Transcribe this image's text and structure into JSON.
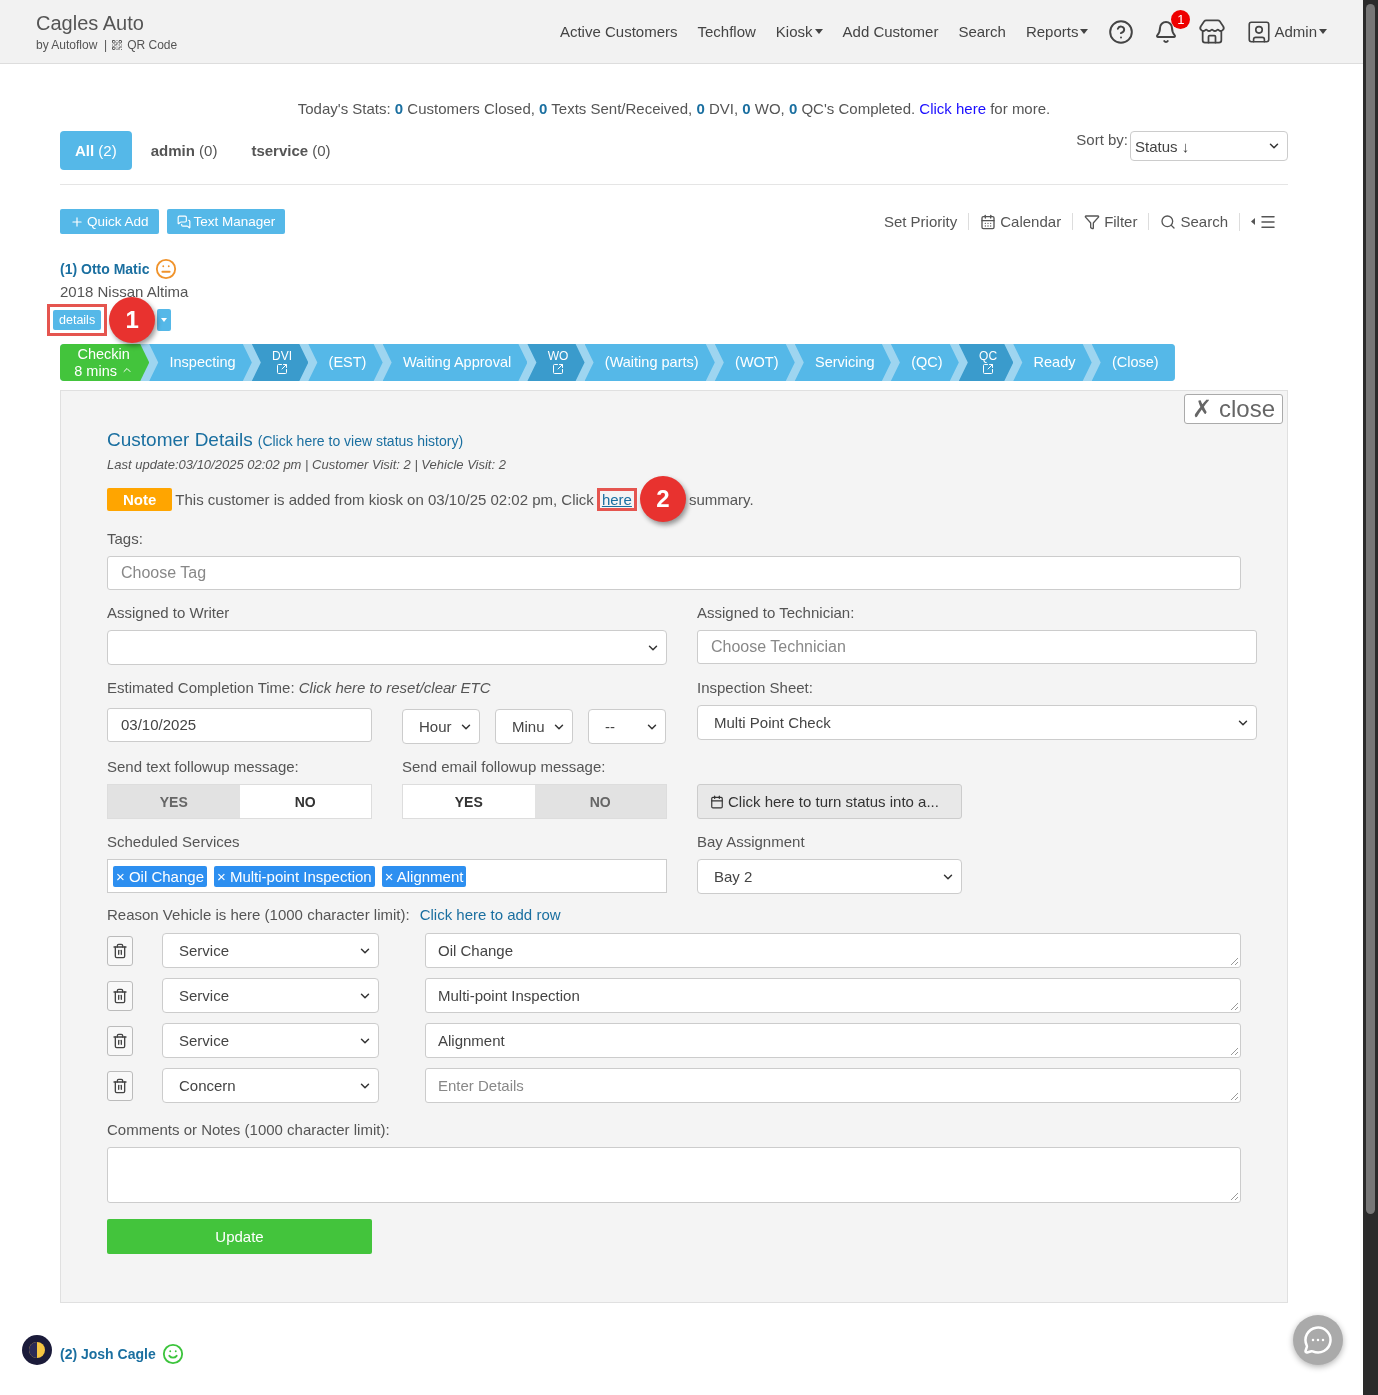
{
  "header": {
    "brand": "Cagles Auto",
    "byline": "by Autoflow  |",
    "qr_label": "QR Code",
    "nav": [
      {
        "label": "Active Customers",
        "dropdown": false
      },
      {
        "label": "Techflow",
        "dropdown": false
      },
      {
        "label": "Kiosk",
        "dropdown": true
      },
      {
        "label": "Add Customer",
        "dropdown": false
      },
      {
        "label": "Search",
        "dropdown": false
      },
      {
        "label": "Reports",
        "dropdown": true
      }
    ],
    "notification_count": "1",
    "user": "Admin"
  },
  "stats": {
    "text": "Today's Stats: **0** Customers Closed, **0** Texts Sent/Received, **0** DVI, **0** WO, **0** QC's Completed.",
    "link": "Click here",
    "suffix": "for more."
  },
  "tabs": [
    {
      "label": "All",
      "count": "(2)",
      "selected": true
    },
    {
      "label": "admin",
      "count": "(0)",
      "selected": false
    },
    {
      "label": "tservice",
      "count": "(0)",
      "selected": false
    }
  ],
  "sort": {
    "label": "Sort by:",
    "value": "Status ↓"
  },
  "actions": [
    "Quick Add",
    "Text Manager"
  ],
  "tools": [
    "Set Priority",
    "Calendar",
    "Filter",
    "Search"
  ],
  "list_menu": {
    "expanded": false
  },
  "customers": [
    {
      "name": "(1) Otto Matic",
      "color": "#f0932b",
      "vehicle": "2018 Nissan Altima",
      "details_button": "details",
      "expanded": true,
      "annotation": "1"
    },
    {
      "name": "(2) Josh Cagle",
      "color": "#3cc43c",
      "expanded": false
    }
  ],
  "pipeline": [
    {
      "label": "Checkin",
      "sub": "8 mins",
      "kind": "current"
    },
    {
      "label": "Inspecting",
      "kind": "step"
    },
    {
      "label": "DVI",
      "kind": "module"
    },
    {
      "label": "(EST)",
      "kind": "step"
    },
    {
      "label": "Waiting Approval",
      "kind": "step"
    },
    {
      "label": "WO",
      "kind": "module"
    },
    {
      "label": "(Waiting parts)",
      "kind": "step"
    },
    {
      "label": "(WOT)",
      "kind": "step"
    },
    {
      "label": "Servicing",
      "kind": "step"
    },
    {
      "label": "(QC)",
      "kind": "step"
    },
    {
      "label": "QC",
      "kind": "module"
    },
    {
      "label": "Ready",
      "kind": "step"
    },
    {
      "label": "(Close)",
      "kind": "step"
    }
  ],
  "details": {
    "close": "✗ close",
    "title": "Customer Details",
    "history_link": "(Click here to view status history)",
    "meta": "Last update:03/10/2025 02:02 pm | Customer Visit: 2 | Vehicle Visit: 2",
    "note_badge": "Note",
    "note_text": "This customer is added from kiosk on 03/10/25 02:02 pm, Click",
    "note_link": "here",
    "note_tail": "summary.",
    "annotation": "2",
    "tags_label": "Tags:",
    "tags_placeholder": "Choose Tag",
    "writer_label": "Assigned to Writer",
    "technician_label": "Assigned to Technician:",
    "technician_placeholder": "Choose Technician",
    "etc_label": "Estimated Completion Time:",
    "etc_link": "Click here to reset/clear ETC",
    "etc_date": "03/10/2025",
    "etc_hour": "Hour",
    "etc_minute": "Minu",
    "etc_ampm": "--",
    "inspection_label": "Inspection Sheet:",
    "inspection_value": "Multi Point Check",
    "text_followup": {
      "label": "Send text followup message:",
      "options": [
        {
          "label": "YES",
          "selected": true
        },
        {
          "label": "NO",
          "selected": false
        }
      ]
    },
    "email_followup": {
      "label": "Send email followup message:",
      "options": [
        {
          "label": "YES",
          "selected": false
        },
        {
          "label": "NO",
          "selected": true
        }
      ]
    },
    "appointment_button": "Click here to turn status into a...",
    "services_label": "Scheduled Services",
    "services": [
      "× Oil Change",
      "× Multi-point Inspection",
      "× Alignment"
    ],
    "bay_label": "Bay Assignment",
    "bay_value": "Bay 2",
    "reason_label": "Reason Vehicle is here (1000 character limit):",
    "add_row": "Click here to add row",
    "reasons": [
      {
        "type": "Service",
        "text": "Oil Change"
      },
      {
        "type": "Service",
        "text": "Multi-point Inspection"
      },
      {
        "type": "Service",
        "text": "Alignment"
      },
      {
        "type": "Concern",
        "placeholder": "Enter Details"
      }
    ],
    "comments_label": "Comments or Notes (1000 character limit):",
    "update": "Update"
  }
}
